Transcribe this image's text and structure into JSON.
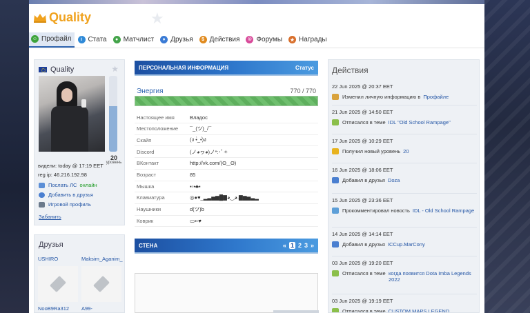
{
  "site": {
    "logo_text": "Quality"
  },
  "tabs": [
    {
      "label": "Профайл",
      "icon": "profile-icon",
      "color": "#3da43a"
    },
    {
      "label": "Стата",
      "icon": "stats-icon",
      "color": "#2f8ad8"
    },
    {
      "label": "Матчлист",
      "icon": "matchlist-icon",
      "color": "#44a44a"
    },
    {
      "label": "Друзья",
      "icon": "friends-icon",
      "color": "#3a7bd5"
    },
    {
      "label": "Действия",
      "icon": "actions-icon",
      "color": "#e08a1e"
    },
    {
      "label": "Форумы",
      "icon": "forums-icon",
      "color": "#d84a9a"
    },
    {
      "label": "Награды",
      "icon": "awards-icon",
      "color": "#d86e2a"
    }
  ],
  "profile": {
    "username": "Quality",
    "level": "20",
    "level_label": "уровень",
    "level_fraction": 0.6,
    "last_seen": "видели: today @ 17:19 EET",
    "reg_ip": "reg ip: 46.216.192.98",
    "send_message": "Послать ЛС",
    "online": "онлайн",
    "add_friend": "Добавить в друзья",
    "game_profile": "Игровой профиль",
    "ban": "Забанить"
  },
  "friends": {
    "title": "Друзья",
    "items": [
      {
        "name": "USHIRO"
      },
      {
        "name": "Maksim_Aganim_"
      },
      {
        "name": "NooB9Ra312"
      },
      {
        "name": "A99-"
      }
    ]
  },
  "personal": {
    "title": "ПЕРСОНАЛЬНАЯ ИНФОРМАЦИЯ",
    "status": "Статус",
    "energy_label": "Энергия",
    "energy_value": "770 / 770",
    "energy_fraction": 1.0,
    "rows": [
      {
        "key": "Настоящее имя",
        "value": "Владос"
      },
      {
        "key": "Местоположение",
        "value": "¯_(ツ)_/¯"
      },
      {
        "key": "Скайп",
        "value": "(ง •̀_•́)ง"
      },
      {
        "key": "Discord",
        "value": "(ノ◕ヮ◕)ノ*:･ﾟ✧"
      },
      {
        "key": "ВКонтакт",
        "value": "http://vk.com/(ʘ‿ʘ)"
      },
      {
        "key": "Возраст",
        "value": "85"
      },
      {
        "key": "Мышка",
        "value": "▪▫▪♣▪"
      },
      {
        "key": "Клавиатура",
        "value": "◎●♥_▂▃▅▆█▇◕‿◕.▇▆▅▃▂"
      },
      {
        "key": "Наушники",
        "value": "d(ツ)b"
      },
      {
        "key": "Коврик",
        "value": "▭▪▫♥"
      }
    ]
  },
  "wall": {
    "title": "СТЕНА",
    "pages": [
      "«",
      "1",
      "2",
      "3",
      "»"
    ]
  },
  "actions": {
    "title": "Действия",
    "items": [
      {
        "date": "22 Jun 2025 @ 20:37 EET",
        "text": "Изменил личную информацию в",
        "link": "Профайле",
        "icon": "wrench-icon",
        "color": "#d9a23c"
      },
      {
        "date": "21 Jun 2025 @ 14:50 EET",
        "text": "Отписался в теме",
        "link": "IDL \"Old School Rampage\"",
        "icon": "post-icon",
        "color": "#8bbf4a"
      },
      {
        "date": "17 Jun 2025 @ 10:29 EET",
        "text": "Получил новый уровень",
        "link": "20",
        "icon": "level-icon",
        "color": "#e8b31e"
      },
      {
        "date": "16 Jun 2025 @ 18:06 EET",
        "text": "Добавил в друзья",
        "link": "Doza",
        "icon": "friend-add-icon",
        "color": "#4a7fd0"
      },
      {
        "date": "15 Jun 2025 @ 23:36 EET",
        "text": "Прокомментировал новость",
        "link": "IDL - Old School Rampage",
        "icon": "comment-icon",
        "color": "#5d9fd8"
      },
      {
        "date": "14 Jun 2025 @ 14:14 EET",
        "text": "Добавил в друзья",
        "link": "ICCup.MarCony",
        "icon": "friend-add-icon",
        "color": "#4a7fd0"
      },
      {
        "date": "03 Jun 2025 @ 19:20 EET",
        "text": "Отписался в теме",
        "link": "когда появится Dota Imba Legends 2022",
        "icon": "post-icon",
        "color": "#8bbf4a"
      },
      {
        "date": "03 Jun 2025 @ 19:19 EET",
        "text": "Отписался в теме",
        "link": "CUSTOM MAPS LEGEND",
        "icon": "post-icon",
        "color": "#8bbf4a"
      }
    ]
  }
}
